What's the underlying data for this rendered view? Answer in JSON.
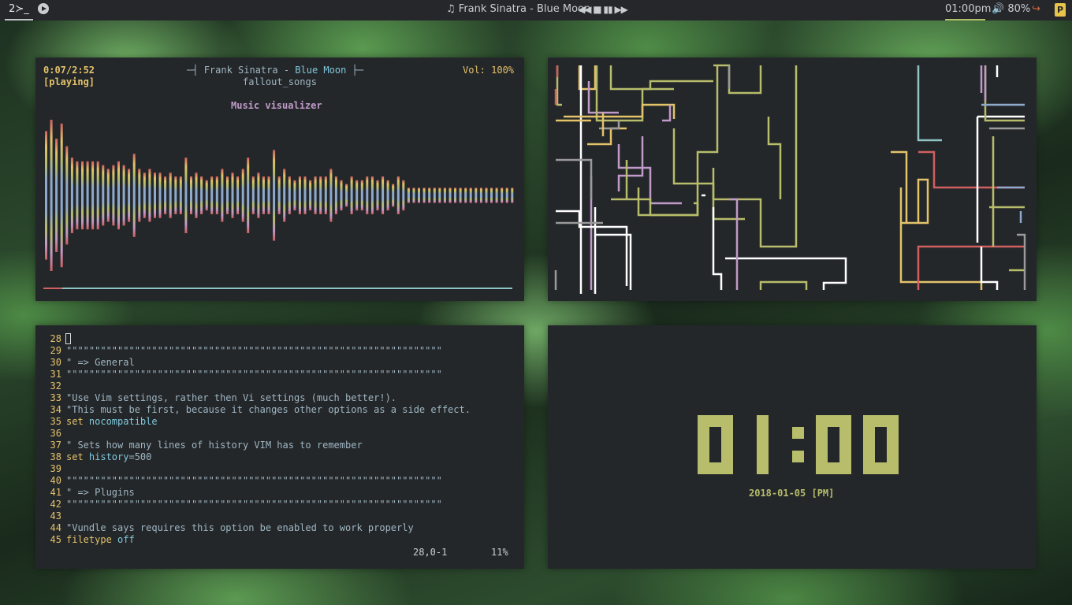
{
  "topbar": {
    "workspace": "2≻_",
    "now_playing": "♫ Frank Sinatra - Blue Moon",
    "controls": "◀◀ ■ ▮▮ ▶▶",
    "clock": "01:00pm",
    "volume": "🔊 80%",
    "logout_icon": "↪",
    "power_icon": "P"
  },
  "player": {
    "elapsed": "0:07/2:52",
    "state": "[playing]",
    "title_left_deco": "─┤",
    "artist_song": "Frank Sinatra - ",
    "song_title": "Blue Moon",
    "title_right_deco": "├─",
    "playlist": "fallout_songs",
    "volume": "Vol: 100%",
    "visualizer_title": "Music visualizer",
    "progress": 0.04,
    "bars": [
      34,
      40,
      30,
      38,
      26,
      20,
      18,
      18,
      18,
      18,
      18,
      16,
      14,
      16,
      18,
      16,
      14,
      22,
      14,
      12,
      14,
      12,
      12,
      10,
      12,
      10,
      10,
      20,
      10,
      12,
      10,
      8,
      10,
      10,
      14,
      10,
      12,
      10,
      14,
      20,
      10,
      12,
      10,
      10,
      24,
      10,
      14,
      10,
      8,
      10,
      10,
      8,
      10,
      10,
      10,
      14,
      10,
      8,
      6,
      10,
      8,
      8,
      10,
      10,
      8,
      10,
      8,
      6,
      10,
      8,
      4,
      4,
      4,
      4,
      4,
      4,
      4,
      4,
      4,
      4,
      4,
      4,
      4,
      4,
      4,
      4,
      4,
      4,
      4,
      4,
      4
    ]
  },
  "vim": {
    "lines": [
      {
        "n": "28",
        "parts": [
          {
            "t": "",
            "c": "cmt"
          }
        ]
      },
      {
        "n": "29",
        "parts": [
          {
            "t": "\"\"\"\"\"\"\"\"\"\"\"\"\"\"\"\"\"\"\"\"\"\"\"\"\"\"\"\"\"\"\"\"\"\"\"\"\"\"\"\"\"\"\"\"\"\"\"\"\"\"\"\"\"\"\"\"\"\"\"\"\"\"\"\"\"\"",
            "c": "cmt"
          }
        ]
      },
      {
        "n": "30",
        "parts": [
          {
            "t": "\" => General",
            "c": "cmt"
          }
        ]
      },
      {
        "n": "31",
        "parts": [
          {
            "t": "\"\"\"\"\"\"\"\"\"\"\"\"\"\"\"\"\"\"\"\"\"\"\"\"\"\"\"\"\"\"\"\"\"\"\"\"\"\"\"\"\"\"\"\"\"\"\"\"\"\"\"\"\"\"\"\"\"\"\"\"\"\"\"\"\"\"",
            "c": "cmt"
          }
        ]
      },
      {
        "n": "32",
        "parts": [
          {
            "t": "",
            "c": "cmt"
          }
        ]
      },
      {
        "n": "33",
        "parts": [
          {
            "t": "\"Use Vim settings, rather then Vi settings (much better!).",
            "c": "cmt"
          }
        ]
      },
      {
        "n": "34",
        "parts": [
          {
            "t": "\"This must be first, because it changes other options as a side effect.",
            "c": "cmt"
          }
        ]
      },
      {
        "n": "35",
        "parts": [
          {
            "t": "set ",
            "c": "kw"
          },
          {
            "t": "nocompatible",
            "c": "opt"
          }
        ]
      },
      {
        "n": "36",
        "parts": [
          {
            "t": "",
            "c": "cmt"
          }
        ]
      },
      {
        "n": "37",
        "parts": [
          {
            "t": "\" Sets how many lines of history VIM has to remember",
            "c": "cmt"
          }
        ]
      },
      {
        "n": "38",
        "parts": [
          {
            "t": "set ",
            "c": "kw"
          },
          {
            "t": "history",
            "c": "opt"
          },
          {
            "t": "=500",
            "c": "cmt"
          }
        ]
      },
      {
        "n": "39",
        "parts": [
          {
            "t": "",
            "c": "cmt"
          }
        ]
      },
      {
        "n": "40",
        "parts": [
          {
            "t": "\"\"\"\"\"\"\"\"\"\"\"\"\"\"\"\"\"\"\"\"\"\"\"\"\"\"\"\"\"\"\"\"\"\"\"\"\"\"\"\"\"\"\"\"\"\"\"\"\"\"\"\"\"\"\"\"\"\"\"\"\"\"\"\"\"\"",
            "c": "cmt"
          }
        ]
      },
      {
        "n": "41",
        "parts": [
          {
            "t": "\" => Plugins",
            "c": "cmt"
          }
        ]
      },
      {
        "n": "42",
        "parts": [
          {
            "t": "\"\"\"\"\"\"\"\"\"\"\"\"\"\"\"\"\"\"\"\"\"\"\"\"\"\"\"\"\"\"\"\"\"\"\"\"\"\"\"\"\"\"\"\"\"\"\"\"\"\"\"\"\"\"\"\"\"\"\"\"\"\"\"\"\"\"",
            "c": "cmt"
          }
        ]
      },
      {
        "n": "43",
        "parts": [
          {
            "t": "",
            "c": "cmt"
          }
        ]
      },
      {
        "n": "44",
        "parts": [
          {
            "t": "\"Vundle says requires this option be enabled to work properly",
            "c": "cmt"
          }
        ]
      },
      {
        "n": "45",
        "parts": [
          {
            "t": "filetype ",
            "c": "kw"
          },
          {
            "t": "off",
            "c": "opt"
          }
        ]
      }
    ],
    "position": "28,0-1",
    "percent": "11%"
  },
  "clock_widget": {
    "time": "01:00",
    "date": "2018-01-05 [PM]"
  },
  "colors": {
    "accent_yellow": "#e3c26a",
    "accent_olive": "#b7bd6a",
    "pipe_colors": [
      "#b7bd6a",
      "#e3c26a",
      "#c09ac8",
      "#ffffff",
      "#8fc4c4",
      "#d06060",
      "#8fa9cc",
      "#9a9a9a"
    ]
  }
}
